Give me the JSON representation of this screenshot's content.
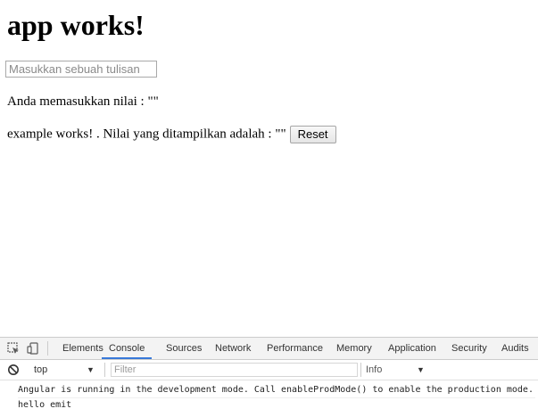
{
  "app": {
    "heading": "app works!",
    "input_placeholder": "Masukkan sebuah tulisan",
    "input_value": "",
    "line1": "Anda memasukkan nilai : \"\"",
    "line2": "example works! . Nilai yang ditampilkan adalah : \"\"",
    "reset_label": "Reset"
  },
  "devtools": {
    "tabs": [
      "Elements",
      "Console",
      "Sources",
      "Network",
      "Performance",
      "Memory",
      "Application",
      "Security",
      "Audits"
    ],
    "active_tab": "Console",
    "accent_color": "#3879d9",
    "context": "top",
    "filter_placeholder": "Filter",
    "level": "Info",
    "icons": {
      "inspect": "inspect-element-icon",
      "device": "device-toggle-icon",
      "clear": "clear-console-icon",
      "dropdown": "chevron-down-icon"
    },
    "console": [
      "Angular is running in the development mode. Call enableProdMode() to enable the production mode.",
      "hello emit"
    ]
  }
}
